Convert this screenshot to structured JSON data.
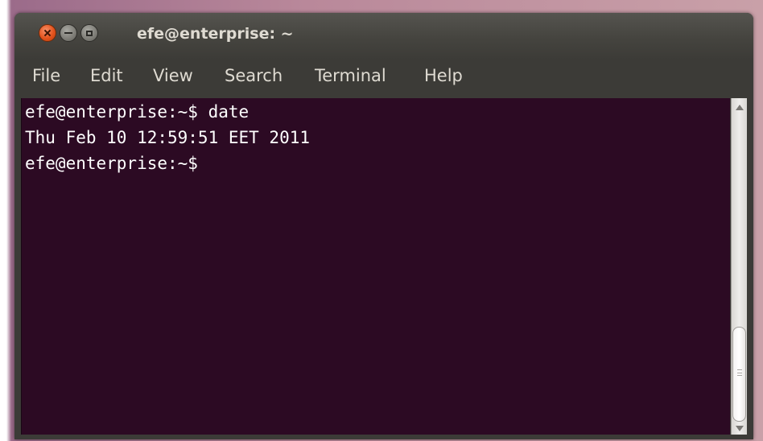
{
  "window": {
    "title": "efe@enterprise: ~"
  },
  "menu": {
    "items": [
      {
        "label": "File"
      },
      {
        "label": "Edit"
      },
      {
        "label": "View"
      },
      {
        "label": "Search"
      },
      {
        "label": "Terminal"
      },
      {
        "label": "Help"
      }
    ]
  },
  "terminal": {
    "lines": [
      {
        "text": "efe@enterprise:~$ date"
      },
      {
        "text": "Thu Feb 10 12:59:51 EET 2011"
      },
      {
        "text": "efe@enterprise:~$"
      }
    ]
  },
  "colors": {
    "terminal_background": "#2c0a23",
    "titlebar_background": "#3c3b37",
    "close_button": "#e2521c",
    "text": "#ffffff"
  },
  "icons": {
    "close": "close-icon",
    "minimize": "minimize-icon",
    "maximize": "maximize-icon"
  }
}
